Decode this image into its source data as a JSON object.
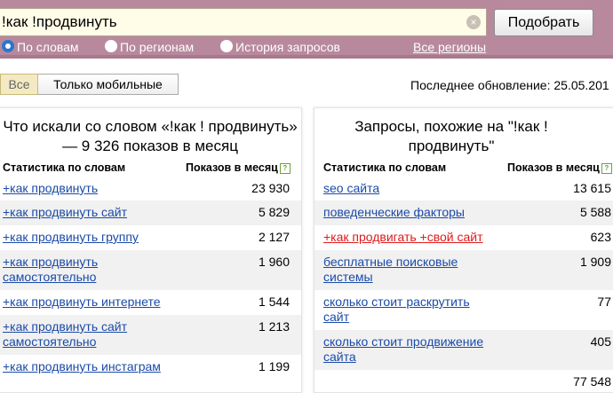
{
  "search": {
    "query": "!как !продвинуть",
    "clear_glyph": "×",
    "submit_label": "Подобрать"
  },
  "modes": {
    "by_words": "По словам",
    "by_regions": "По регионам",
    "history": "История запросов",
    "all_regions": "Все регионы"
  },
  "filters": {
    "all": "Все",
    "mobile_only": "Только мобильные"
  },
  "last_update": "Последнее обновление: 25.05.201",
  "help_glyph": "?",
  "left_panel": {
    "title": "Что искали со словом «!как ! продвинуть» — 9 326 показов в месяц",
    "col_phrase": "Статистика по словам",
    "col_count": "Показов в месяц",
    "rows": [
      {
        "phrase": "+как продвинуть",
        "count": "23 930"
      },
      {
        "phrase": "+как продвинуть сайт",
        "count": "5 829"
      },
      {
        "phrase": "+как продвинуть группу",
        "count": "2 127"
      },
      {
        "phrase": "+как продвинуть самостоятельно",
        "count": "1 960"
      },
      {
        "phrase": "+как продвинуть интернете",
        "count": "1 544"
      },
      {
        "phrase": "+как продвинуть сайт самостоятельно",
        "count": "1 213"
      },
      {
        "phrase": "+как продвинуть инстаграм",
        "count": "1 199"
      }
    ]
  },
  "right_panel": {
    "title": "Запросы, похожие на \"!как ! продвинуть\"",
    "col_phrase": "Статистика по словам",
    "col_count": "Показов в месяц",
    "rows": [
      {
        "phrase": "seo сайта",
        "count": "13 615"
      },
      {
        "phrase": "поведенческие факторы",
        "count": "5 588"
      },
      {
        "phrase": "+как продвигать +свой сайт",
        "count": "623"
      },
      {
        "phrase": "бесплатные поисковые системы",
        "count": "1 909"
      },
      {
        "phrase": "сколько стоит раскрутить сайт",
        "count": "77"
      },
      {
        "phrase": "сколько стоит продвижение сайта",
        "count": "405"
      },
      {
        "phrase": "",
        "count": "77 548"
      }
    ]
  },
  "colors": {
    "header_bg": "#b8899d",
    "link": "#1a4aa8",
    "link_alert": "#e01a1a",
    "radio_selected": "#2a76d0"
  }
}
